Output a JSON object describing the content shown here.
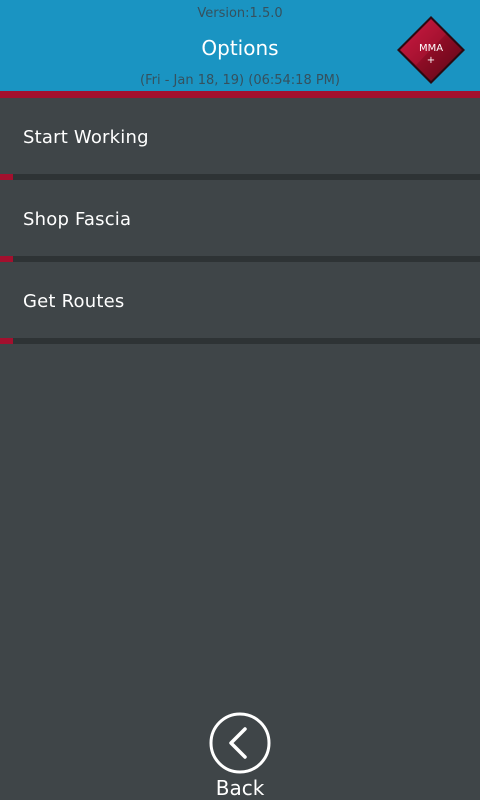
{
  "header": {
    "version": "Version:1.5.0",
    "title": "Options",
    "datetime": "(Fri - Jan 18, 19) (06:54:18 PM)",
    "logo_text": "MMA",
    "logo_plus": "+"
  },
  "menu": {
    "items": [
      {
        "label": "Start Working"
      },
      {
        "label": "Shop Fascia"
      },
      {
        "label": "Get Routes"
      }
    ]
  },
  "footer": {
    "back_label": "Back"
  },
  "colors": {
    "header_bg": "#1a94c2",
    "accent_red": "#a3102e",
    "body_bg": "#3f4548",
    "divider": "#2e3335"
  },
  "icons": {
    "back": "chevron-left-circle-icon",
    "logo": "mma-diamond-logo"
  }
}
